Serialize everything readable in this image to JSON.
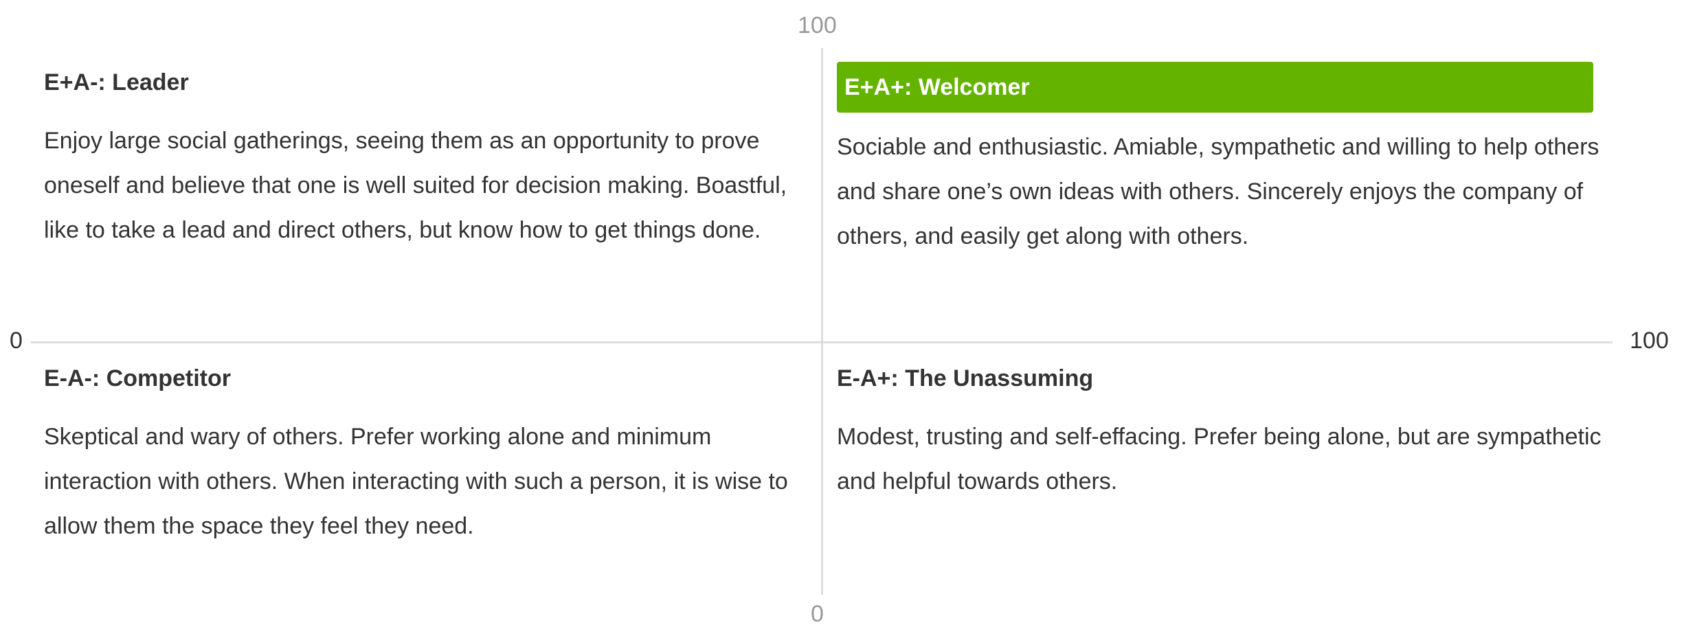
{
  "axes": {
    "y_max_label": "100",
    "y_min_label": "0",
    "x_min_label": "0",
    "x_max_label": "100"
  },
  "quadrants": {
    "top_left": {
      "title": "E+A-: Leader",
      "text": "Enjoy large social gatherings, seeing them as an opportunity to prove oneself and believe that one is well suited for decision making. Boastful, like to take a lead and direct others, but know how to get things done.",
      "highlighted": false
    },
    "top_right": {
      "title": "E+A+: Welcomer",
      "text": "Sociable and enthusiastic. Amiable, sympathetic and willing to help others and share one’s own ideas with others. Sincerely enjoys the company of others, and easily get along with others.",
      "highlighted": true
    },
    "bottom_left": {
      "title": "E-A-: Competitor",
      "text": "Skeptical and wary of others. Prefer working alone and minimum interaction with others. When interacting with such a person, it is wise to allow them the space they feel they need.",
      "highlighted": false
    },
    "bottom_right": {
      "title": "E-A+: The Unassuming",
      "text": "Modest, trusting and self-effacing. Prefer being alone, but are sympathetic and helpful towards others.",
      "highlighted": false
    }
  },
  "colors": {
    "highlight": "#64b300",
    "axis_line": "#dddddd",
    "axis_label_muted": "#999999",
    "text": "#333333"
  }
}
